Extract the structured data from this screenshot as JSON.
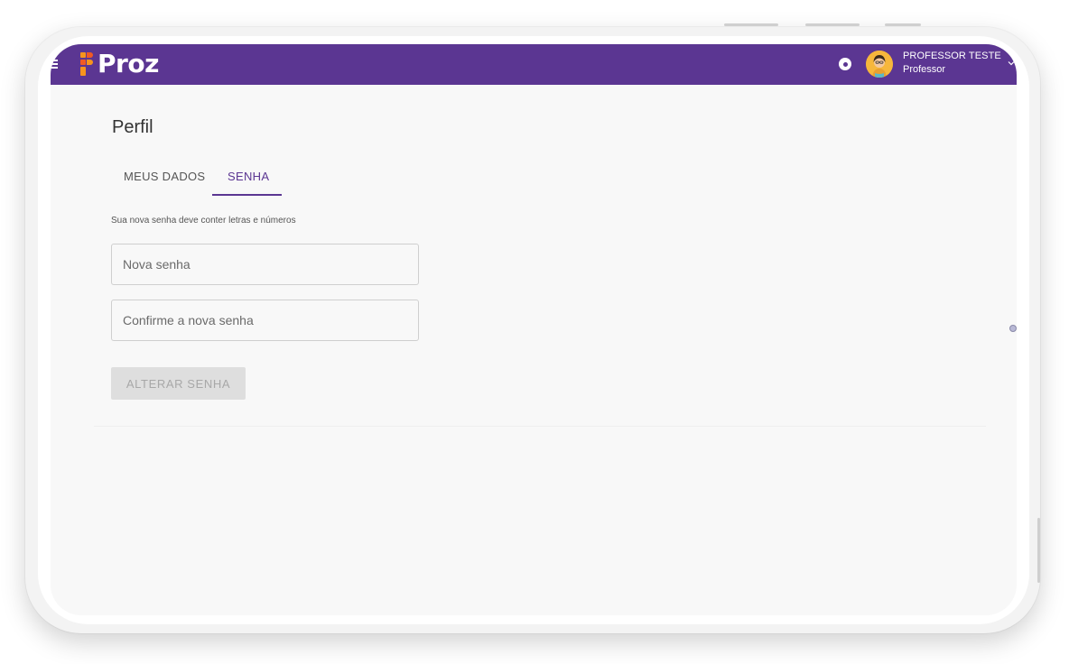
{
  "header": {
    "logo_text": "Proz",
    "user_name": "PROFESSOR TESTE",
    "user_role": "Professor",
    "brand_color": "#5b3692",
    "icons": [
      "menu-icon",
      "bell-icon",
      "chevron-down-icon"
    ]
  },
  "page": {
    "title": "Perfil",
    "tabs": [
      {
        "label": "MEUS DADOS",
        "active": false
      },
      {
        "label": "SENHA",
        "active": true
      }
    ],
    "hint": "Sua nova senha deve conter letras e números"
  },
  "form": {
    "new_password_placeholder": "Nova senha",
    "confirm_password_placeholder": "Confirme a nova senha",
    "submit_label": "ALTERAR SENHA"
  }
}
